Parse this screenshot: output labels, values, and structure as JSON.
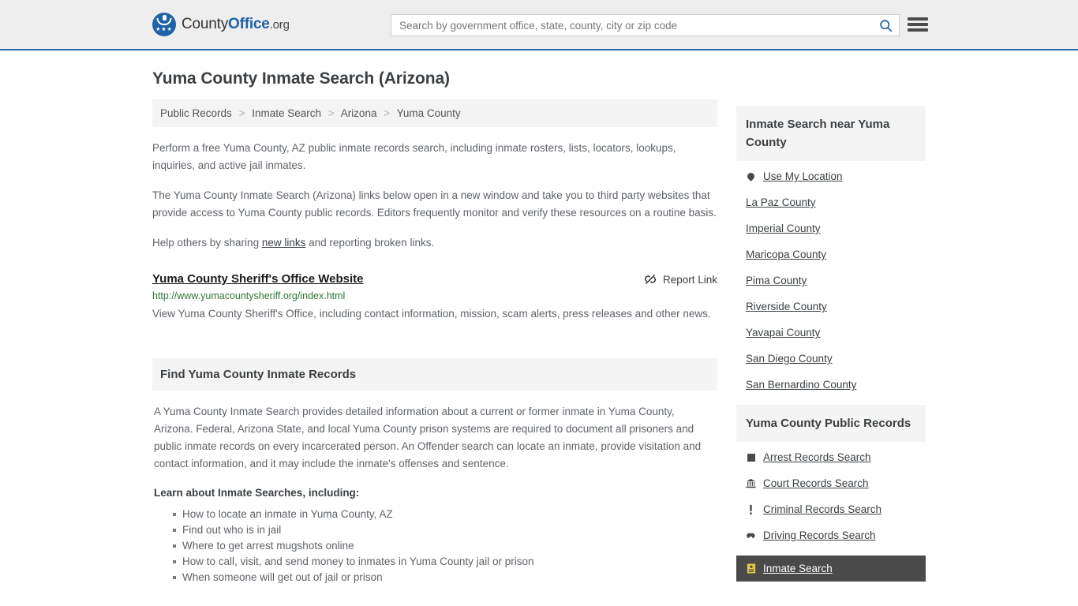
{
  "header": {
    "brand_prefix": "County",
    "brand_bold": "Office",
    "brand_tld": ".org",
    "search_placeholder": "Search by government office, state, county, city or zip code",
    "search_value": "",
    "search_icon": "search-icon",
    "menu_icon": "hamburger-menu-icon",
    "accent_color": "#1e62a8",
    "border_color": "#2d6ca2"
  },
  "main": {
    "page_title": "Yuma County Inmate Search (Arizona)",
    "breadcrumb": [
      "Public Records",
      "Inmate Search",
      "Arizona",
      "Yuma County"
    ],
    "breadcrumb_separator": ">",
    "intro_paragraph": "Perform a free Yuma County, AZ public inmate records search, including inmate rosters, lists, locators, lookups, inquiries, and active jail inmates.",
    "second_paragraph": "The Yuma County Inmate Search (Arizona) links below open in a new window and take you to third party websites that provide access to Yuma County public records. Editors frequently monitor and verify these resources on a routine basis.",
    "help_prefix": "Help others by sharing ",
    "help_link": "new links",
    "help_suffix": " and reporting broken links.",
    "result": {
      "title": "Yuma County Sheriff's Office Website",
      "report_label": "Report Link",
      "report_icon": "broken-link-icon",
      "url": "http://www.yumacountysheriff.org/index.html",
      "url_color": "#2a7a3b",
      "description": "View Yuma County Sheriff's Office, including contact information, mission, scam alerts, press releases and other news."
    },
    "section": {
      "heading": "Find Yuma County Inmate Records",
      "paragraph": "A Yuma County Inmate Search provides detailed information about a current or former inmate in Yuma County, Arizona. Federal, Arizona State, and local Yuma County prison systems are required to document all prisoners and public inmate records on every incarcerated person. An Offender search can locate an inmate, provide visitation and contact information, and it may include the inmate's offenses and sentence.",
      "subheading": "Learn about Inmate Searches, including:",
      "bullets": [
        "How to locate an inmate in Yuma County, AZ",
        "Find out who is in jail",
        "Where to get arrest mugshots online",
        "How to call, visit, and send money to inmates in Yuma County jail or prison",
        "When someone will get out of jail or prison"
      ]
    }
  },
  "sidebar": {
    "near_panel": {
      "heading": "Inmate Search near Yuma County",
      "items": [
        {
          "label": "Use My Location",
          "icon": "map-pin-icon",
          "has_icon": true
        },
        {
          "label": "La Paz County",
          "icon": "",
          "has_icon": false
        },
        {
          "label": "Imperial County",
          "icon": "",
          "has_icon": false
        },
        {
          "label": "Maricopa County",
          "icon": "",
          "has_icon": false
        },
        {
          "label": "Pima County",
          "icon": "",
          "has_icon": false
        },
        {
          "label": "Riverside County",
          "icon": "",
          "has_icon": false
        },
        {
          "label": "Yavapai County",
          "icon": "",
          "has_icon": false
        },
        {
          "label": "San Diego County",
          "icon": "",
          "has_icon": false
        },
        {
          "label": "San Bernardino County",
          "icon": "",
          "has_icon": false
        }
      ]
    },
    "records_panel": {
      "heading": "Yuma County Public Records",
      "items": [
        {
          "label": "Arrest Records Search",
          "icon": "square-icon",
          "active": false
        },
        {
          "label": "Court Records Search",
          "icon": "courthouse-icon",
          "active": false
        },
        {
          "label": "Criminal Records Search",
          "icon": "exclamation-icon",
          "active": false
        },
        {
          "label": "Driving Records Search",
          "icon": "car-icon",
          "active": false
        },
        {
          "label": "Inmate Search",
          "icon": "id-card-icon",
          "active": true
        }
      ],
      "active_bg": "#4a4a4a",
      "active_icon_color": "#e8c84a"
    }
  }
}
